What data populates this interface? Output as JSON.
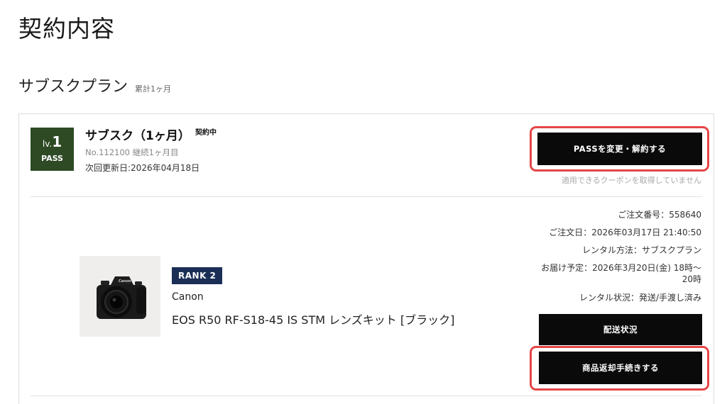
{
  "page": {
    "title": "契約内容"
  },
  "plan_section": {
    "title": "サブスクプラン",
    "subtitle": "累計1ヶ月"
  },
  "plan": {
    "badge_level_prefix": "lv.",
    "badge_level_num": "1",
    "badge_label": "PASS",
    "name": "サブスク（1ヶ月）",
    "status": "契約中",
    "number": "No.112100 継続1ヶ月目",
    "next_renewal": "次回更新日:2026年04月18日",
    "change_button": "PASSを変更・解約する",
    "coupon_note": "適用できるクーポンを取得していません"
  },
  "order": {
    "number": "ご注文番号：558640",
    "date": "ご注文日：2026年03月17日 21:40:50",
    "rental_method": "レンタル方法：サブスクプラン",
    "delivery_line1": "お届け予定：2026年3月20日(金) 18時〜",
    "delivery_line2": "20時",
    "rental_status": "レンタル状況：発送/手渡し済み",
    "shipping_button": "配送状況",
    "return_button": "商品返却手続きする"
  },
  "product": {
    "rank": "RANK 2",
    "brand": "Canon",
    "name": "EOS R50 RF-S18-45 IS STM レンズキット [ブラック]",
    "image_logo_text": "Canon"
  },
  "colors": {
    "pass_badge": "#2d4a24",
    "rank_badge": "#1b2f56",
    "button_bg": "#0a0a0a",
    "highlight": "#e54546"
  }
}
